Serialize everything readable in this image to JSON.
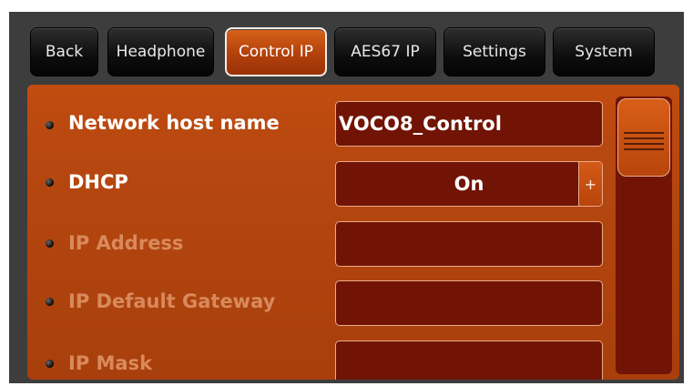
{
  "tabs": [
    {
      "label": "Back",
      "active": false
    },
    {
      "label": "Headphone",
      "active": false
    },
    {
      "label": "Control IP",
      "active": true
    },
    {
      "label": "AES67 IP",
      "active": false
    },
    {
      "label": "Settings",
      "active": false
    },
    {
      "label": "System",
      "active": false
    }
  ],
  "rows": [
    {
      "label": "Network host name",
      "value": "VOCO8_Control",
      "enabled": true
    },
    {
      "label": "DHCP",
      "value": "On",
      "enabled": true,
      "control": "stepper",
      "step_symbol": "+"
    },
    {
      "label": "IP Address",
      "value": "",
      "enabled": false
    },
    {
      "label": "IP Default Gateway",
      "value": "",
      "enabled": false
    },
    {
      "label": "IP Mask",
      "value": "",
      "enabled": false
    }
  ],
  "colors": {
    "panel": "#b84810",
    "field": "#711405",
    "active_tab": "#c24c10",
    "tab": "#0d0d0d"
  }
}
